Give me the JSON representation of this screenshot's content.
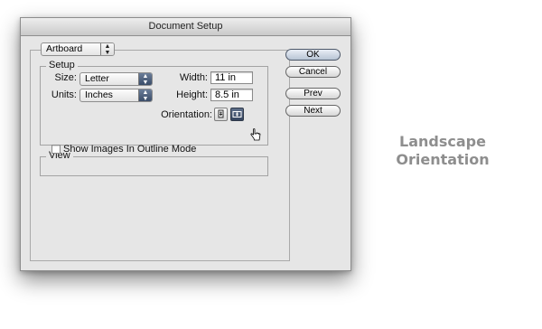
{
  "dialog": {
    "title": "Document Setup"
  },
  "artboard_popup": {
    "value": "Artboard"
  },
  "setup": {
    "legend": "Setup",
    "size_label": "Size:",
    "size_value": "Letter",
    "units_label": "Units:",
    "units_value": "Inches",
    "width_label": "Width:",
    "width_value": "11 in",
    "height_label": "Height:",
    "height_value": "8.5 in",
    "orientation_label": "Orientation:",
    "orientation_selected": "landscape"
  },
  "view": {
    "legend": "View",
    "checkbox_label": "Show Images In Outline Mode",
    "checkbox_checked": false
  },
  "buttons": {
    "ok": "OK",
    "cancel": "Cancel",
    "prev": "Prev",
    "next": "Next"
  },
  "caption": {
    "line1": "Landscape",
    "line2": "Orientation"
  },
  "colors": {
    "dialog_bg": "#e6e6e6",
    "selected_blue": "#3a4c68",
    "caption_gray": "#8e8e8e"
  },
  "icons": [
    "chevron-updown-icon",
    "portrait-orientation-icon",
    "landscape-orientation-icon",
    "hand-cursor-icon"
  ]
}
